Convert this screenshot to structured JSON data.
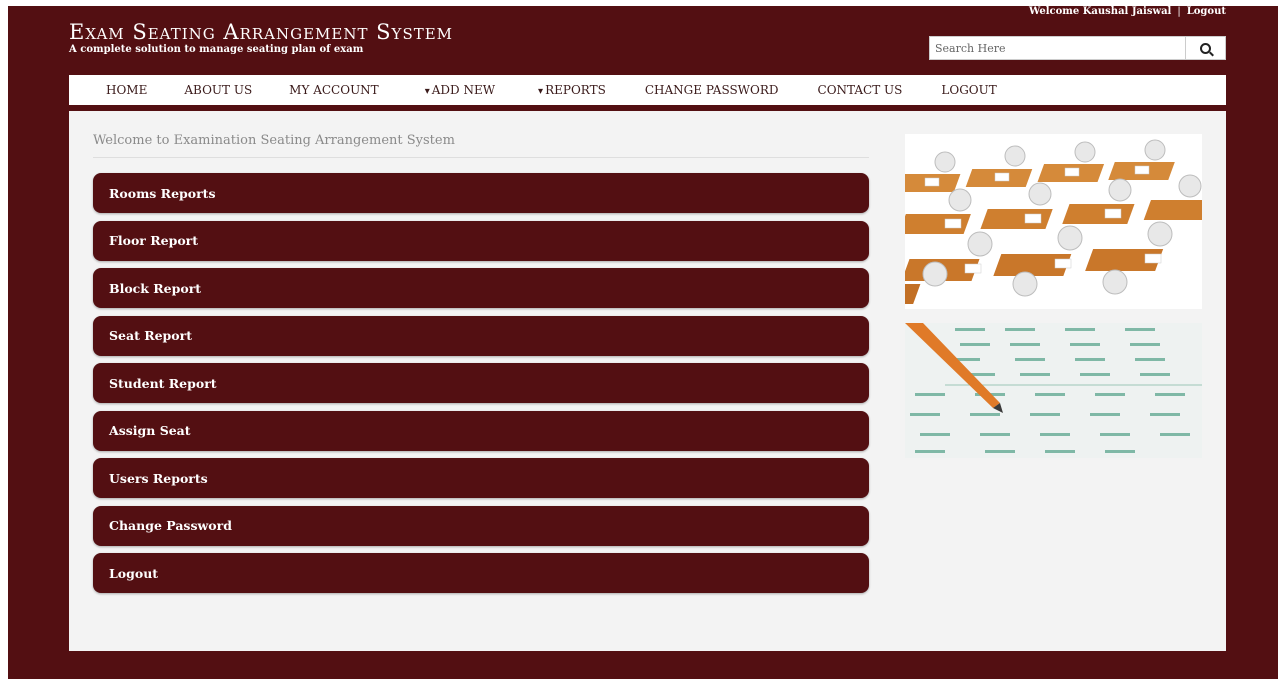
{
  "header": {
    "title": "Exam Seating Arrangement System",
    "subtitle": "A complete solution to manage seating plan of exam",
    "welcome_user": "Welcome Kaushal Jaiswal",
    "separator": "|",
    "logout_link": "Logout"
  },
  "search": {
    "placeholder": "Search Here"
  },
  "nav": {
    "items": [
      {
        "label": "HOME"
      },
      {
        "label": "ABOUT US"
      },
      {
        "label": "MY ACCOUNT"
      },
      {
        "label": "ADD NEW",
        "caret": "▾"
      },
      {
        "label": "REPORTS",
        "caret": "▾"
      },
      {
        "label": "CHANGE PASSWORD"
      },
      {
        "label": "CONTACT US"
      },
      {
        "label": "LOGOUT"
      }
    ]
  },
  "main": {
    "welcome_text": "Welcome to Examination Seating Arrangement System",
    "menu": [
      {
        "label": "Rooms Reports"
      },
      {
        "label": "Floor Report"
      },
      {
        "label": "Block Report"
      },
      {
        "label": "Seat Report"
      },
      {
        "label": "Student Report"
      },
      {
        "label": "Assign Seat"
      },
      {
        "label": "Users Reports"
      },
      {
        "label": "Change Password"
      },
      {
        "label": "Logout"
      }
    ]
  },
  "theme": {
    "brand_color": "#530f12",
    "content_bg": "#f3f3f3"
  },
  "icons": {
    "search": "search-icon"
  }
}
